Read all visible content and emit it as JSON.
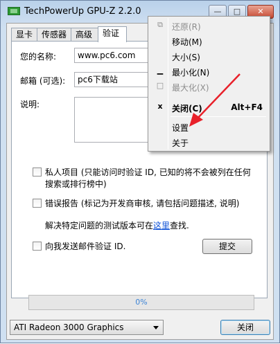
{
  "window": {
    "title": "TechPowerUp GPU-Z 2.2.0",
    "caption_min": "—",
    "caption_max": "□",
    "caption_close": "✕"
  },
  "tabs": [
    {
      "label": "显卡"
    },
    {
      "label": "传感器"
    },
    {
      "label": "高级"
    },
    {
      "label": "验证"
    }
  ],
  "form": {
    "name_label": "您的名称:",
    "name_value": "www.pc6.com",
    "email_label": "邮箱 (可选):",
    "email_value": "pc6下载站",
    "desc_label": "说明:",
    "private_line1": "私人项目 (只能访问时验证 ID, 已知的将不会被列在任何",
    "private_line2": "搜索或排行榜中)",
    "bug_report": "错误报告 (标记为开发商审核, 请包括问题描述, 说明)",
    "resolve_prefix": "解决特定问题的测试版本可在",
    "resolve_link": "这里",
    "resolve_suffix": "查找.",
    "email_me": "向我发送邮件验证 ID.",
    "submit": "提交",
    "progress": "0%"
  },
  "bottom": {
    "gpu_select": "ATI Radeon 3000 Graphics",
    "close": "关闭"
  },
  "menu": {
    "items": [
      {
        "icon": "⧉",
        "label": "还原(R)",
        "accel": "",
        "disabled": true
      },
      {
        "icon": "",
        "label": "移动(M)",
        "accel": "",
        "disabled": false
      },
      {
        "icon": "",
        "label": "大小(S)",
        "accel": "",
        "disabled": false
      },
      {
        "icon": "▁",
        "label": "最小化(N)",
        "accel": "",
        "disabled": false
      },
      {
        "icon": "□",
        "label": "最大化(X)",
        "accel": "",
        "disabled": true
      },
      {
        "icon": "x",
        "label": "关闭(C)",
        "accel": "Alt+F4",
        "disabled": false
      },
      {
        "icon": "",
        "label": "设置",
        "accel": "",
        "disabled": false
      },
      {
        "icon": "",
        "label": "关于",
        "accel": "",
        "disabled": false
      }
    ]
  },
  "colors": {
    "annotation_arrow": "#e8202a",
    "link": "#0b4fd6",
    "progress_text": "#3d84d6"
  }
}
